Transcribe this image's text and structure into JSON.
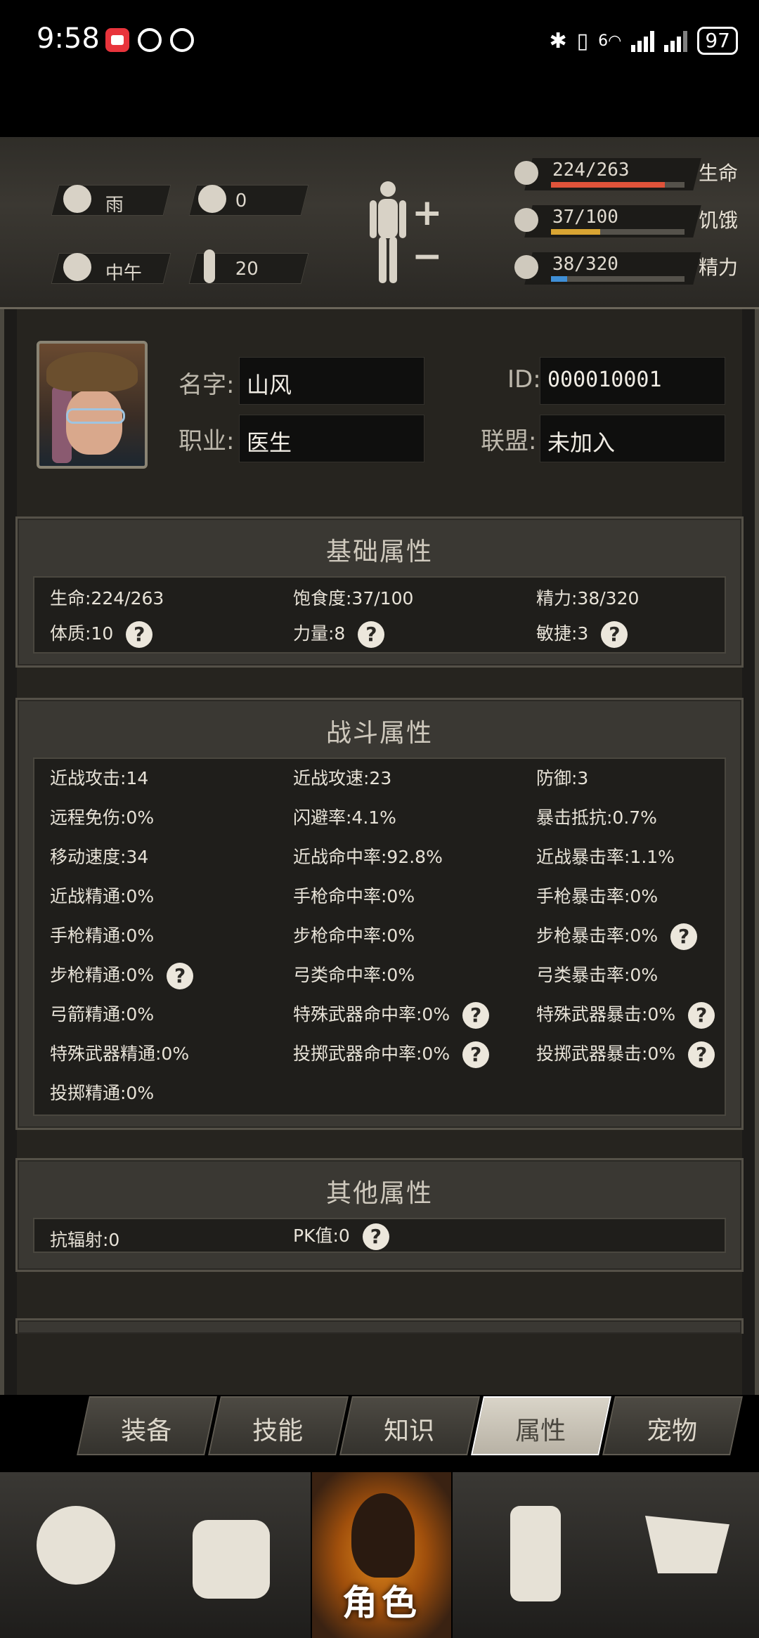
{
  "status_bar": {
    "time": "9:58",
    "network": "6",
    "battery": "97"
  },
  "hud": {
    "weather": "雨",
    "radiation": "0",
    "time_of_day": "中午",
    "temperature": "20",
    "health": {
      "value": "224/263",
      "label": "生命",
      "fraction": 0.852,
      "color": "#e0533a"
    },
    "hunger": {
      "value": "37/100",
      "label": "饥饿",
      "fraction": 0.37,
      "color": "#d9a533"
    },
    "energy": {
      "value": "38/320",
      "label": "精力",
      "fraction": 0.119,
      "color": "#3f8fd6"
    }
  },
  "profile": {
    "name_label": "名字:",
    "name": "山风",
    "job_label": "职业:",
    "job": "医生",
    "id_label": "ID:",
    "id": "000010001",
    "alliance_label": "联盟:",
    "alliance": "未加入"
  },
  "basic": {
    "title": "基础属性",
    "items": [
      "生命:224/263",
      "饱食度:37/100",
      "精力:38/320",
      "体质:10",
      "力量:8",
      "敏捷:3"
    ]
  },
  "combat": {
    "title": "战斗属性",
    "items": [
      "近战攻击:14",
      "近战攻速:23",
      "防御:3",
      "远程免伤:0%",
      "闪避率:4.1%",
      "暴击抵抗:0.7%",
      "移动速度:34",
      "近战命中率:92.8%",
      "近战暴击率:1.1%",
      "近战精通:0%",
      "手枪命中率:0%",
      "手枪暴击率:0%",
      "手枪精通:0%",
      "步枪命中率:0%",
      "步枪暴击率:0%",
      "步枪精通:0%",
      "弓类命中率:0%",
      "弓类暴击率:0%",
      "弓箭精通:0%",
      "特殊武器命中率:0%",
      "特殊武器暴击:0%",
      "特殊武器精通:0%",
      "投掷武器命中率:0%",
      "投掷武器暴击:0%",
      "投掷精通:0%"
    ]
  },
  "other": {
    "title": "其他属性",
    "items": [
      "抗辐射:0",
      "PK值:0"
    ]
  },
  "help_symbol": "?",
  "tabs": [
    "装备",
    "技能",
    "知识",
    "属性",
    "宠物"
  ],
  "bottom_nav": {
    "items": [
      "world-map-icon",
      "backpack-icon",
      "character-icon",
      "radio-icon",
      "shop-cart-icon"
    ],
    "active_label": "角色"
  }
}
